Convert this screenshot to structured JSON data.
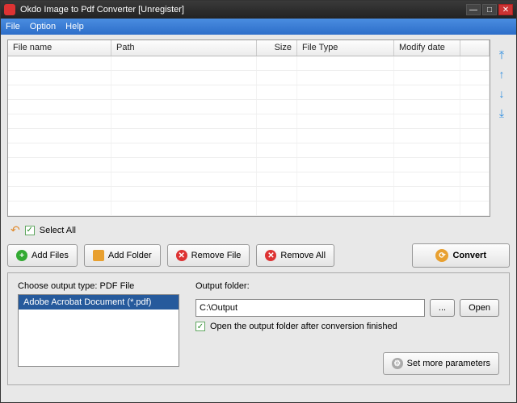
{
  "window": {
    "title": "Okdo Image to Pdf Converter [Unregister]"
  },
  "menu": {
    "file": "File",
    "option": "Option",
    "help": "Help"
  },
  "table": {
    "cols": {
      "name": "File name",
      "path": "Path",
      "size": "Size",
      "type": "File Type",
      "modify": "Modify date"
    }
  },
  "actions": {
    "selectAll": "Select All",
    "addFiles": "Add Files",
    "addFolder": "Add Folder",
    "removeFile": "Remove File",
    "removeAll": "Remove All",
    "convert": "Convert"
  },
  "output": {
    "chooseLabel": "Choose output type:  PDF File",
    "typeItem": "Adobe Acrobat Document (*.pdf)",
    "folderLabel": "Output folder:",
    "folderPath": "C:\\Output",
    "browse": "...",
    "open": "Open",
    "openAfter": "Open the output folder after conversion finished",
    "moreParams": "Set more parameters"
  }
}
